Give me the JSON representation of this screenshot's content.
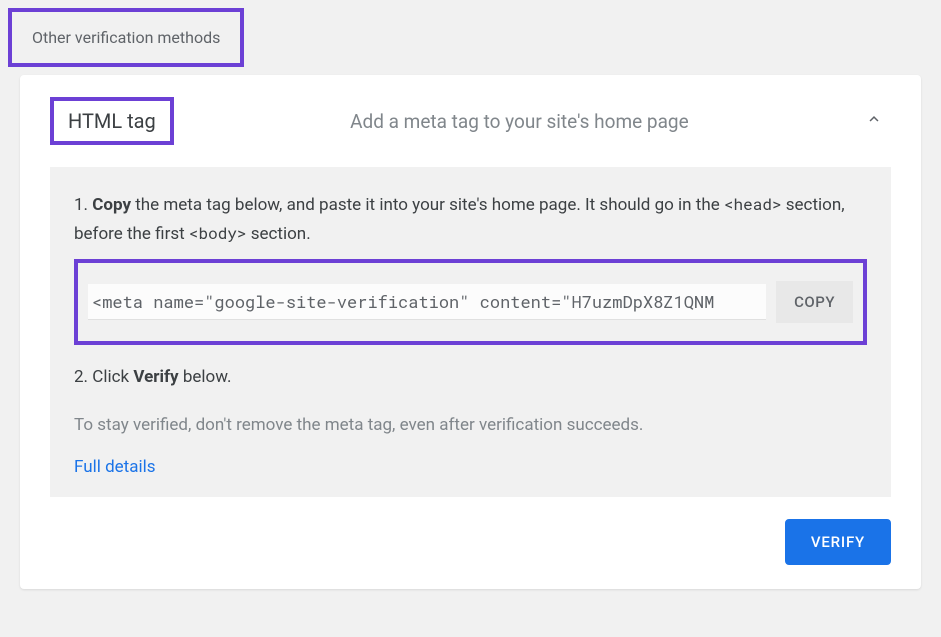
{
  "section_header": "Other verification methods",
  "method": {
    "title": "HTML tag",
    "subtitle": "Add a meta tag to your site's home page"
  },
  "step1": {
    "prefix": "1. ",
    "bold": "Copy",
    "text_a": " the meta tag below, and paste it into your site's home page. It should go in the ",
    "code_a": "<head>",
    "text_b": " section, before the first ",
    "code_b": "<body>",
    "text_c": " section."
  },
  "meta_tag_value": "<meta name=\"google-site-verification\" content=\"H7uzmDpX8Z1QNM",
  "copy_label": "COPY",
  "step2": {
    "prefix": "2. Click ",
    "bold": "Verify",
    "suffix": " below."
  },
  "note": "To stay verified, don't remove the meta tag, even after verification succeeds.",
  "full_details_label": "Full details",
  "verify_label": "VERIFY"
}
